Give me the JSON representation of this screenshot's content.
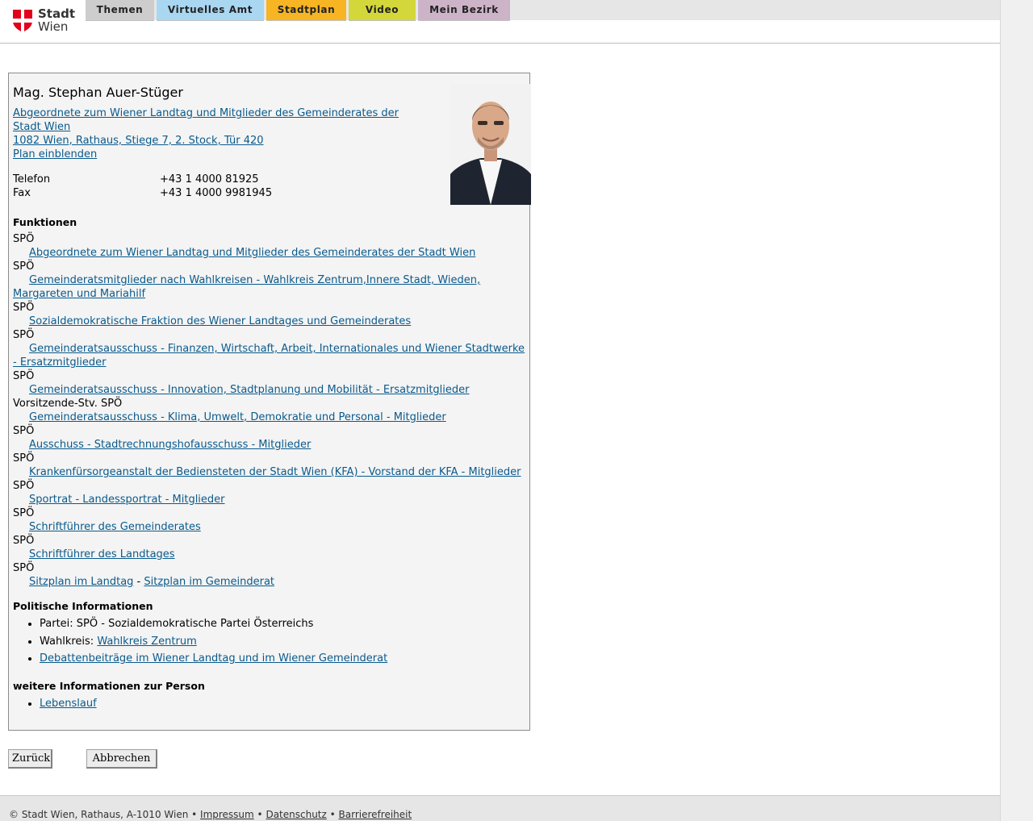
{
  "header": {
    "logo_line1": "Stadt",
    "logo_line2": "Wien",
    "tabs": [
      {
        "label": "Themen"
      },
      {
        "label": "Virtuelles Amt"
      },
      {
        "label": "Stadtplan"
      },
      {
        "label": "Video"
      },
      {
        "label": "Mein Bezirk"
      }
    ]
  },
  "person": {
    "name": "Mag. Stephan Auer-Stüger",
    "org_line1": "Abgeordnete zum Wiener Landtag und Mitglieder des Gemeinderates der Stadt Wien ",
    "address": "1082 Wien, Rathaus, Stiege 7, 2. Stock, Tür 420",
    "plan_link": "Plan einblenden",
    "phone_label": "Telefon",
    "phone": "+43 1 4000 81925",
    "fax_label": "Fax",
    "fax": "+43 1 4000 9981945"
  },
  "functions": {
    "heading": "Funktionen",
    "items": [
      {
        "party": "SPÖ",
        "link": "Abgeordnete zum Wiener Landtag und Mitglieder des Gemeinderates der Stadt Wien"
      },
      {
        "party": "SPÖ",
        "link": "Gemeinderatsmitglieder nach Wahlkreisen - Wahlkreis Zentrum,Innere Stadt, Wieden, Margareten und Mariahilf"
      },
      {
        "party": "SPÖ",
        "link": "Sozialdemokratische Fraktion des Wiener Landtages und Gemeinderates"
      },
      {
        "party": "SPÖ",
        "link": "Gemeinderatsausschuss - Finanzen, Wirtschaft, Arbeit, Internationales und Wiener Stadtwerke - Ersatzmitglieder"
      },
      {
        "party": "SPÖ",
        "link": "Gemeinderatsausschuss - Innovation, Stadtplanung und Mobilität - Ersatzmitglieder"
      },
      {
        "party": "Vorsitzende-Stv. SPÖ",
        "link": "Gemeinderatsausschuss - Klima, Umwelt, Demokratie und Personal - Mitglieder"
      },
      {
        "party": "SPÖ",
        "link": "Ausschuss - Stadtrechnungshofausschuss - Mitglieder"
      },
      {
        "party": "SPÖ",
        "link": "Krankenfürsorgeanstalt der Bediensteten der Stadt Wien (KFA) - Vorstand der KFA - Mitglieder"
      },
      {
        "party": "SPÖ",
        "link": "Sportrat - Landessportrat - Mitglieder"
      },
      {
        "party": "SPÖ",
        "link": "Schriftführer des Gemeinderates"
      },
      {
        "party": "SPÖ",
        "link": "Schriftführer des Landtages"
      }
    ],
    "last_party": "SPÖ",
    "seat_landtag": "Sitzplan im Landtag",
    "seat_separator": " - ",
    "seat_gemeinderat": "Sitzplan im Gemeinderat"
  },
  "political": {
    "heading": "Politische Informationen",
    "party_label": "Partei: SPÖ - Sozialdemokratische Partei Österreichs",
    "wahlkreis_prefix": "Wahlkreis: ",
    "wahlkreis_link": "Wahlkreis Zentrum",
    "debate_link": "Debattenbeiträge im Wiener Landtag und im Wiener Gemeinderat"
  },
  "more": {
    "heading": "weitere Informationen zur Person",
    "cv_link": "Lebenslauf"
  },
  "buttons": {
    "back": "Zurück",
    "cancel": "Abbrechen"
  },
  "footer": {
    "copyright": "© Stadt Wien, Rathaus, A-1010 Wien",
    "sep": " • ",
    "impressum": "Impressum",
    "datenschutz": "Datenschutz",
    "barrierefreiheit": "Barrierefreiheit"
  },
  "colors": {
    "link": "#0a5a8c",
    "tab_themen": "#cdcdcd",
    "tab_amt": "#a9d7f1",
    "tab_plan": "#f7b524",
    "tab_video": "#d3d73a",
    "tab_bezirk": "#cdb3c8",
    "logo_red": "#e2001a"
  }
}
